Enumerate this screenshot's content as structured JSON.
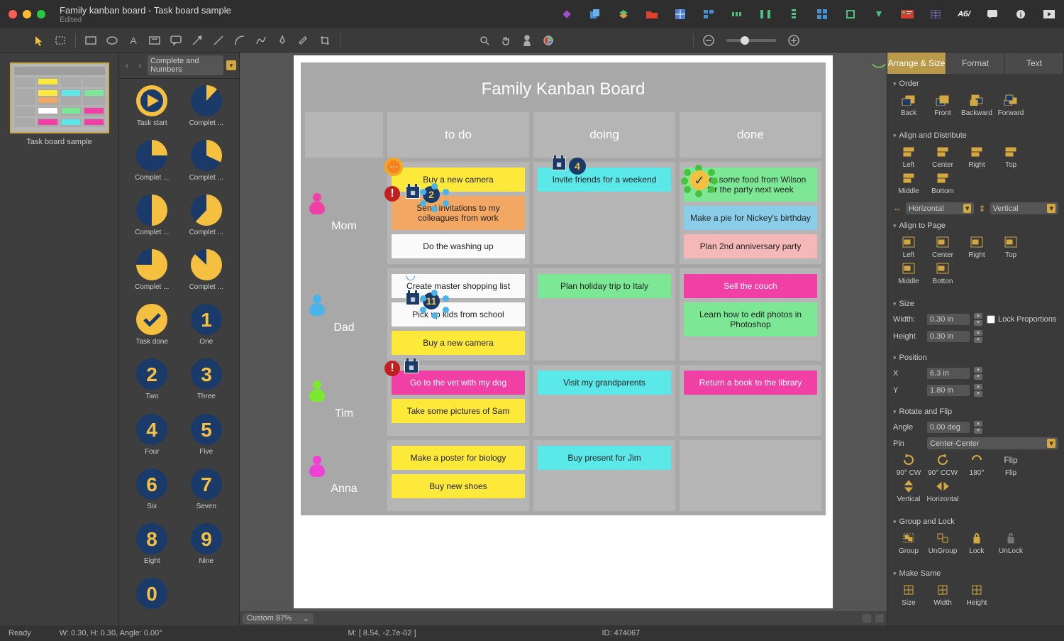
{
  "title": "Family kanban board - Task board sample",
  "subtitle": "Edited",
  "thumb_label": "Task board sample",
  "shape_lib_name": "Complete and Numbers",
  "shapes": [
    {
      "label": "Task start",
      "type": "play"
    },
    {
      "label": "Complet ...",
      "type": "pie12"
    },
    {
      "label": "Complet ...",
      "type": "pie25"
    },
    {
      "label": "Complet ...",
      "type": "pie32"
    },
    {
      "label": "Complet ...",
      "type": "pie50"
    },
    {
      "label": "Complet ...",
      "type": "pie62"
    },
    {
      "label": "Complet ...",
      "type": "pie75"
    },
    {
      "label": "Complet ...",
      "type": "pie87"
    },
    {
      "label": "Task done",
      "type": "check"
    },
    {
      "label": "One",
      "type": "num",
      "n": "1"
    },
    {
      "label": "Two",
      "type": "num",
      "n": "2"
    },
    {
      "label": "Three",
      "type": "num",
      "n": "3"
    },
    {
      "label": "Four",
      "type": "num",
      "n": "4"
    },
    {
      "label": "Five",
      "type": "num",
      "n": "5"
    },
    {
      "label": "Six",
      "type": "num",
      "n": "6"
    },
    {
      "label": "Seven",
      "type": "num",
      "n": "7"
    },
    {
      "label": "Eight",
      "type": "num",
      "n": "8"
    },
    {
      "label": "Nine",
      "type": "num",
      "n": "9"
    },
    {
      "label": "",
      "type": "num",
      "n": "0"
    }
  ],
  "board": {
    "title": "Family Kanban Board",
    "columns": [
      "to do",
      "doing",
      "done"
    ],
    "rows": [
      {
        "name": "Mom",
        "color": "#f040a5",
        "cells": [
          [
            {
              "text": "Buy a new camera",
              "color": "yellow",
              "badges": [
                "comment"
              ]
            },
            {
              "text": "Send invitations to my colleagues from work",
              "color": "orange",
              "badges": [
                "alert",
                "cal",
                "num2",
                "selected"
              ]
            },
            {
              "text": "Do the washing up",
              "color": "white"
            }
          ],
          [
            {
              "text": "Invite friends for a weekend",
              "color": "cyan",
              "badges": [
                "cal",
                "num4"
              ]
            }
          ],
          [
            {
              "text": "Order some food from Wilson for the party next week",
              "color": "green",
              "badges": [
                "checkdone"
              ]
            },
            {
              "text": "Make a pie for Nickey's birthday",
              "color": "coolblue"
            },
            {
              "text": "Plan 2nd anniversary party",
              "color": "salmon"
            }
          ]
        ]
      },
      {
        "name": "Dad",
        "color": "#4ab4e8",
        "cells": [
          [
            {
              "text": "Create master shopping list",
              "color": "white",
              "badges": [
                "spinner"
              ]
            },
            {
              "text": "Pick up kids from school",
              "color": "white",
              "badges": [
                "cal",
                "num11",
                "selected"
              ]
            },
            {
              "text": "Buy a new camera",
              "color": "yellow"
            }
          ],
          [
            {
              "text": "Plan holiday trip to Italy",
              "color": "green"
            }
          ],
          [
            {
              "text": "Sell the couch",
              "color": "magenta"
            },
            {
              "text": "Learn how to edit photos in Photoshop",
              "color": "green"
            }
          ]
        ]
      },
      {
        "name": "Tim",
        "color": "#7ce830",
        "cells": [
          [
            {
              "text": "Go to the vet with my dog",
              "color": "magenta",
              "badges": [
                "alert",
                "cal2"
              ]
            },
            {
              "text": "Take some pictures of Sam",
              "color": "yellow"
            }
          ],
          [
            {
              "text": "Visit my grandparents",
              "color": "cyan"
            }
          ],
          [
            {
              "text": "Return a book to the library",
              "color": "magenta"
            }
          ]
        ]
      },
      {
        "name": "Anna",
        "color": "#f040d5",
        "cells": [
          [
            {
              "text": "Make a poster for biology",
              "color": "yellow"
            },
            {
              "text": "Buy new shoes",
              "color": "yellow"
            }
          ],
          [
            {
              "text": "Buy present for Jim",
              "color": "cyan"
            }
          ],
          []
        ]
      }
    ]
  },
  "zoom_label": "Custom 87%",
  "panel": {
    "tabs": [
      "Arrange & Size",
      "Format",
      "Text"
    ],
    "order_label": "Order",
    "order": [
      "Back",
      "Front",
      "Backward",
      "Forward"
    ],
    "align_label": "Align and Distribute",
    "align": [
      "Left",
      "Center",
      "Right",
      "Top",
      "Middle",
      "Bottom"
    ],
    "dist_h": "Horizontal",
    "dist_v": "Vertical",
    "align_page_label": "Align to Page",
    "align_page": [
      "Left",
      "Center",
      "Right",
      "Top",
      "Middle",
      "Botton"
    ],
    "size_label": "Size",
    "width_label": "Width:",
    "width": "0.30 in",
    "height_label": "Height",
    "height": "0.30 in",
    "lock_prop": "Lock Proportions",
    "position_label": "Position",
    "x_label": "X",
    "x": "6.3 in",
    "y_label": "Y",
    "y": "1.80 in",
    "rotate_label": "Rotate and Flip",
    "angle_label": "Angle",
    "angle": "0.00 deg",
    "pin_label": "Pin",
    "pin": "Center-Center",
    "rotate_btns": [
      "90° CW",
      "90° CCW",
      "180°",
      "Flip",
      "Vertical",
      "Horizontal"
    ],
    "group_label": "Group and Lock",
    "group_btns": [
      "Group",
      "UnGroup",
      "Lock",
      "UnLock"
    ],
    "same_label": "Make Same",
    "same_btns": [
      "Size",
      "Width",
      "Height"
    ]
  },
  "status": {
    "ready": "Ready",
    "wh": "W: 0.30,  H: 0.30,  Angle: 0.00°",
    "mouse": "M: [ 8.54, -2.7e-02 ]",
    "id": "ID: 474067"
  }
}
